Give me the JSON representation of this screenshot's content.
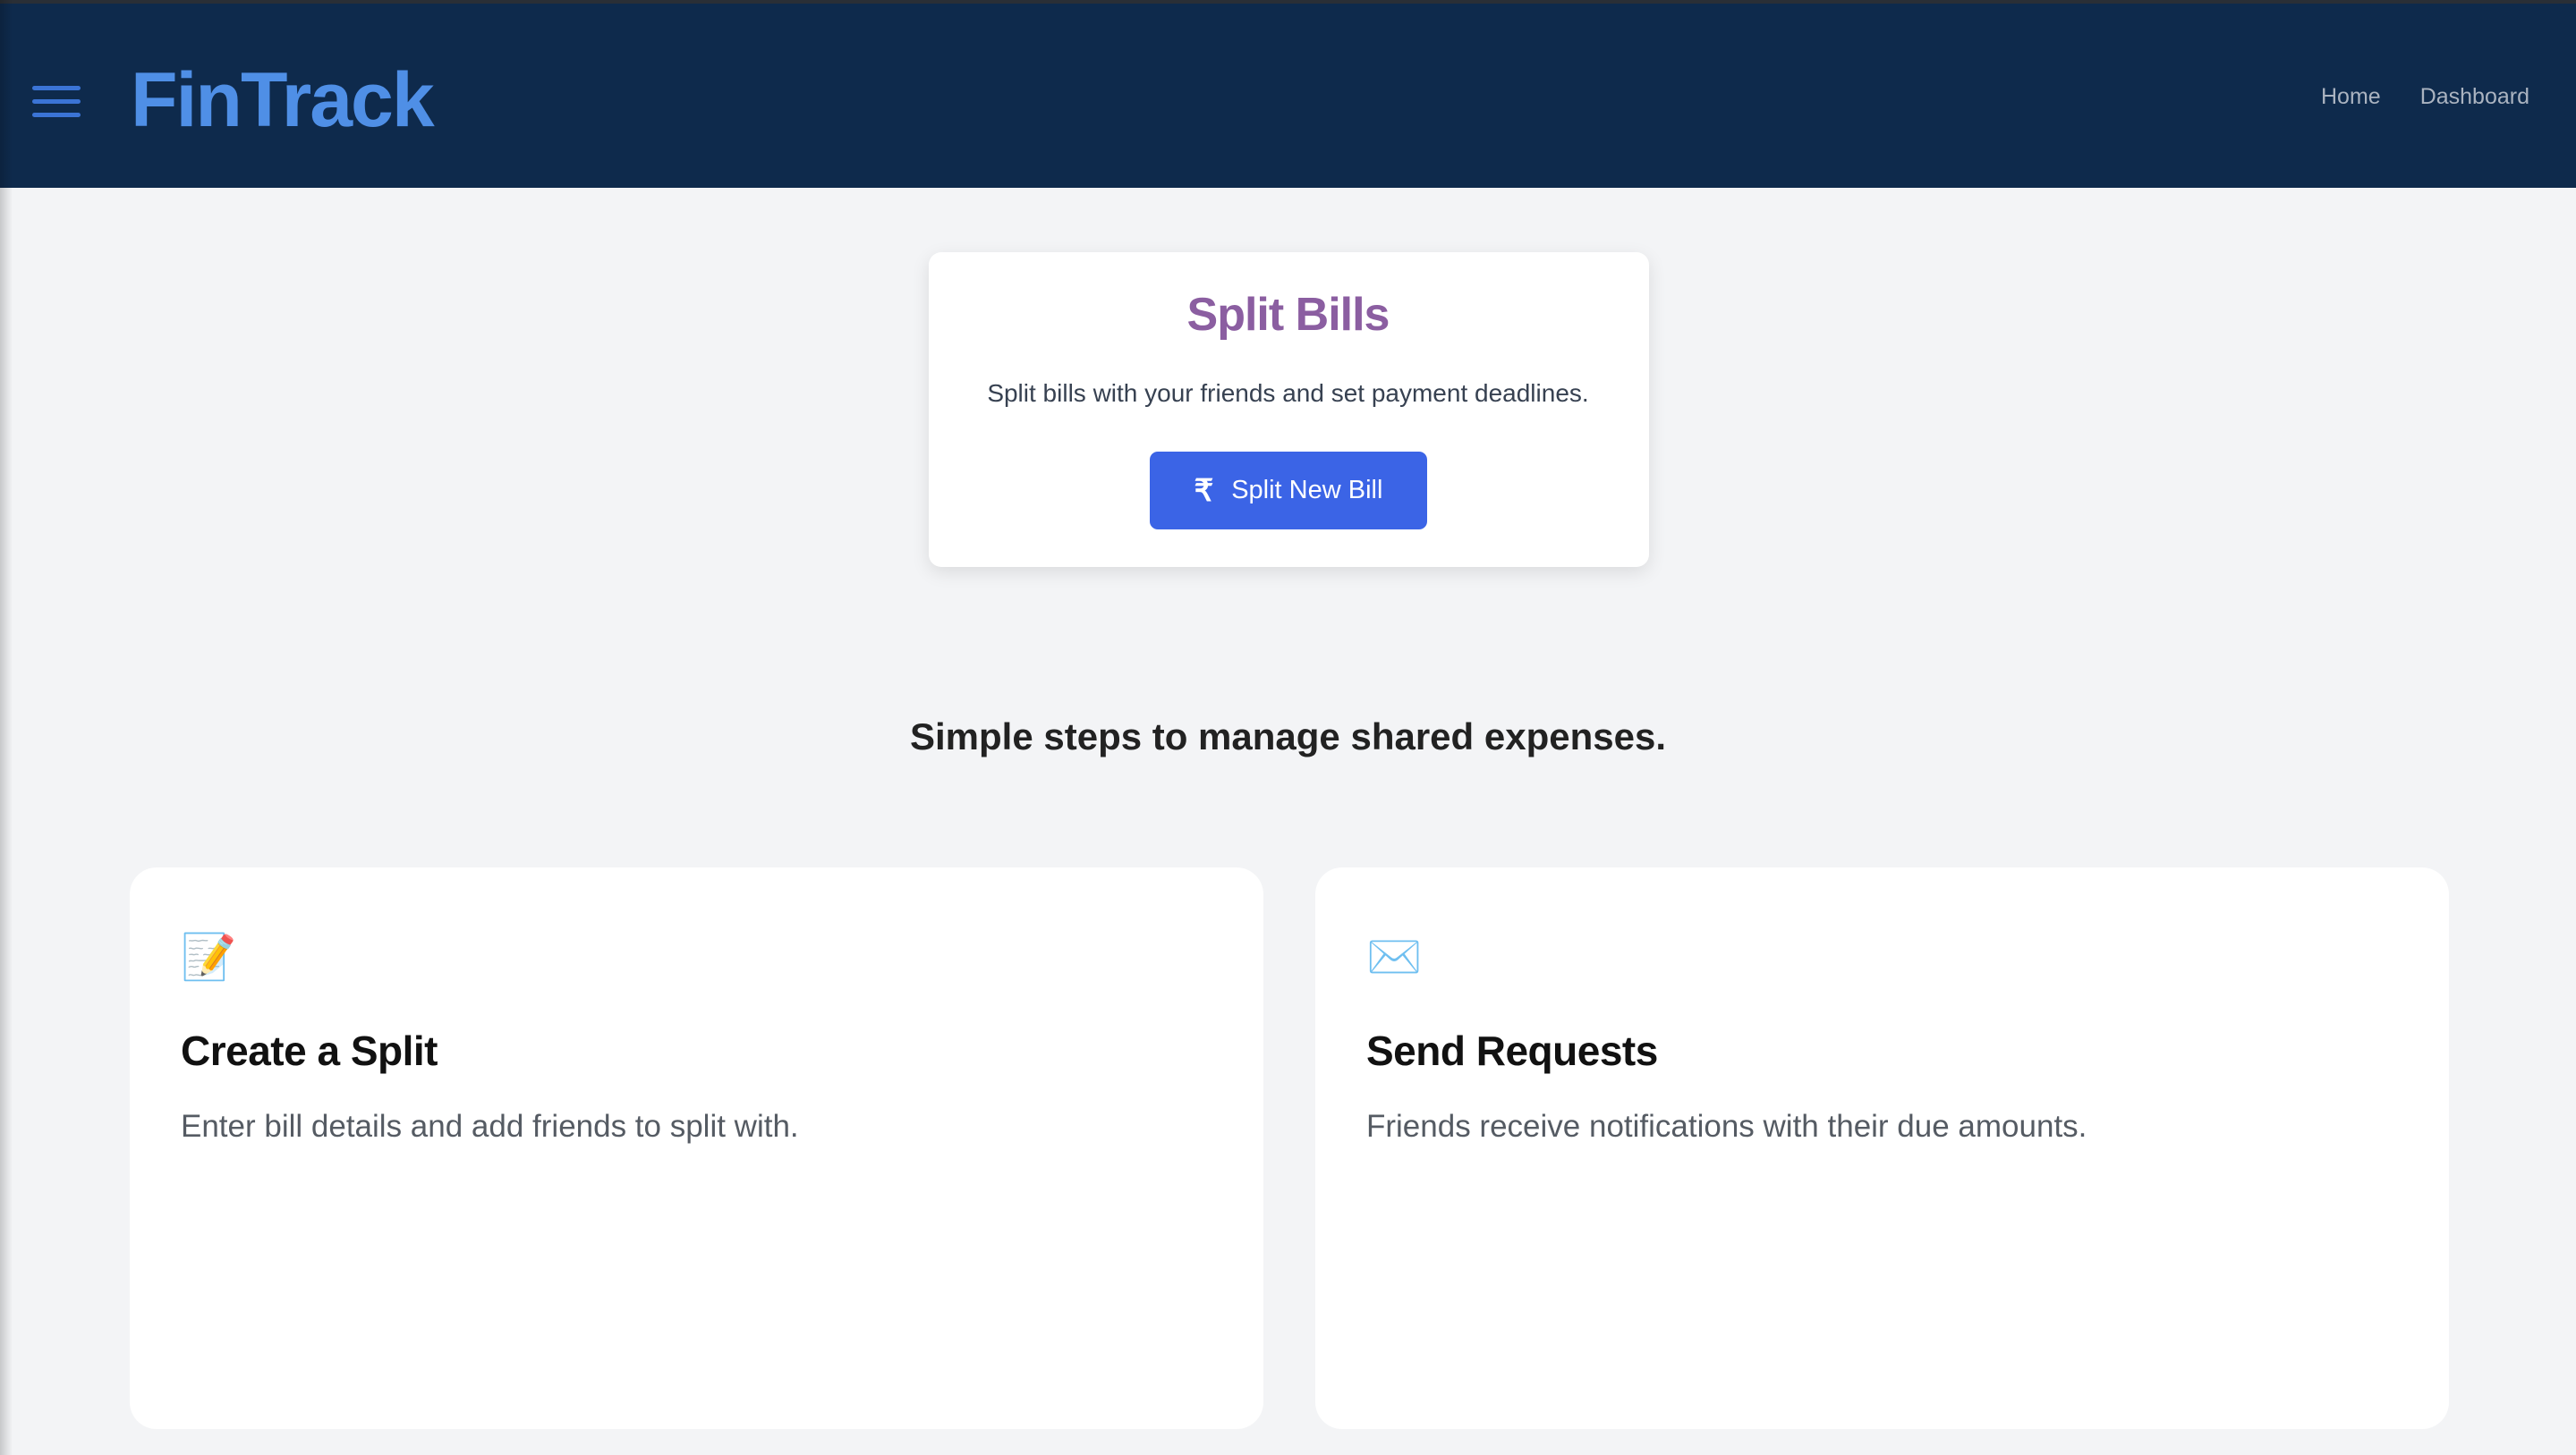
{
  "header": {
    "brand": "FinTrack",
    "nav": [
      {
        "label": "Home"
      },
      {
        "label": "Dashboard"
      }
    ]
  },
  "split_card": {
    "title": "Split Bills",
    "description": "Split bills with your friends and set payment deadlines.",
    "button_icon": "₹",
    "button_label": "Split New Bill"
  },
  "steps": {
    "heading": "Simple steps to manage shared expenses.",
    "items": [
      {
        "icon": "📝",
        "icon_name": "memo-icon",
        "title": "Create a Split",
        "description": "Enter bill details and add friends to split with."
      },
      {
        "icon": "✉️",
        "icon_name": "envelope-icon",
        "title": "Send Requests",
        "description": "Friends receive notifications with their due amounts."
      }
    ]
  },
  "colors": {
    "topbar": "#0e2a4c",
    "brand": "#4f8fe6",
    "button": "#3b64e6",
    "title": "#8b5ea1",
    "background": "#f3f4f6"
  }
}
